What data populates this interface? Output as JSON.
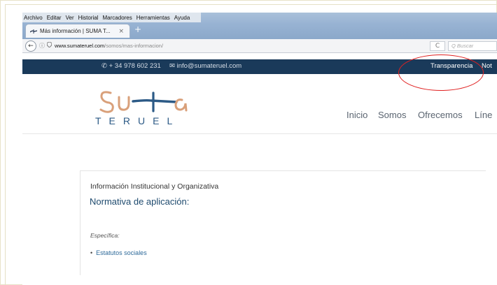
{
  "browser": {
    "menu": [
      "Archivo",
      "Editar",
      "Ver",
      "Historial",
      "Marcadores",
      "Herramientas",
      "Ayuda"
    ],
    "tab_title": "Más información | SUMA T...",
    "tab_close": "×",
    "new_tab": "+",
    "url_domain": "www.sumateruel.com",
    "url_path": "/somos/mas-informacion/",
    "reload": "C",
    "search_placeholder": "Q Buscar"
  },
  "site": {
    "phone": "+ 34 978 602 231",
    "email": "info@sumateruel.com",
    "transparency": "Transparencia",
    "top_truncated": "Not",
    "logo_sub": "TERUEL",
    "nav": [
      "Inicio",
      "Somos",
      "Ofrecemos",
      "Líne"
    ]
  },
  "content": {
    "title": "Información Institucional y Organizativa",
    "heading": "Normativa de aplicación:",
    "especifica": "Específica:",
    "link": "Estatutos sociales"
  },
  "colors": {
    "topbar": "#1a3a5a",
    "logo_orange": "#d9a07a",
    "logo_blue": "#2c5a86",
    "link": "#2e6a9a",
    "annotation": "#e02020"
  }
}
